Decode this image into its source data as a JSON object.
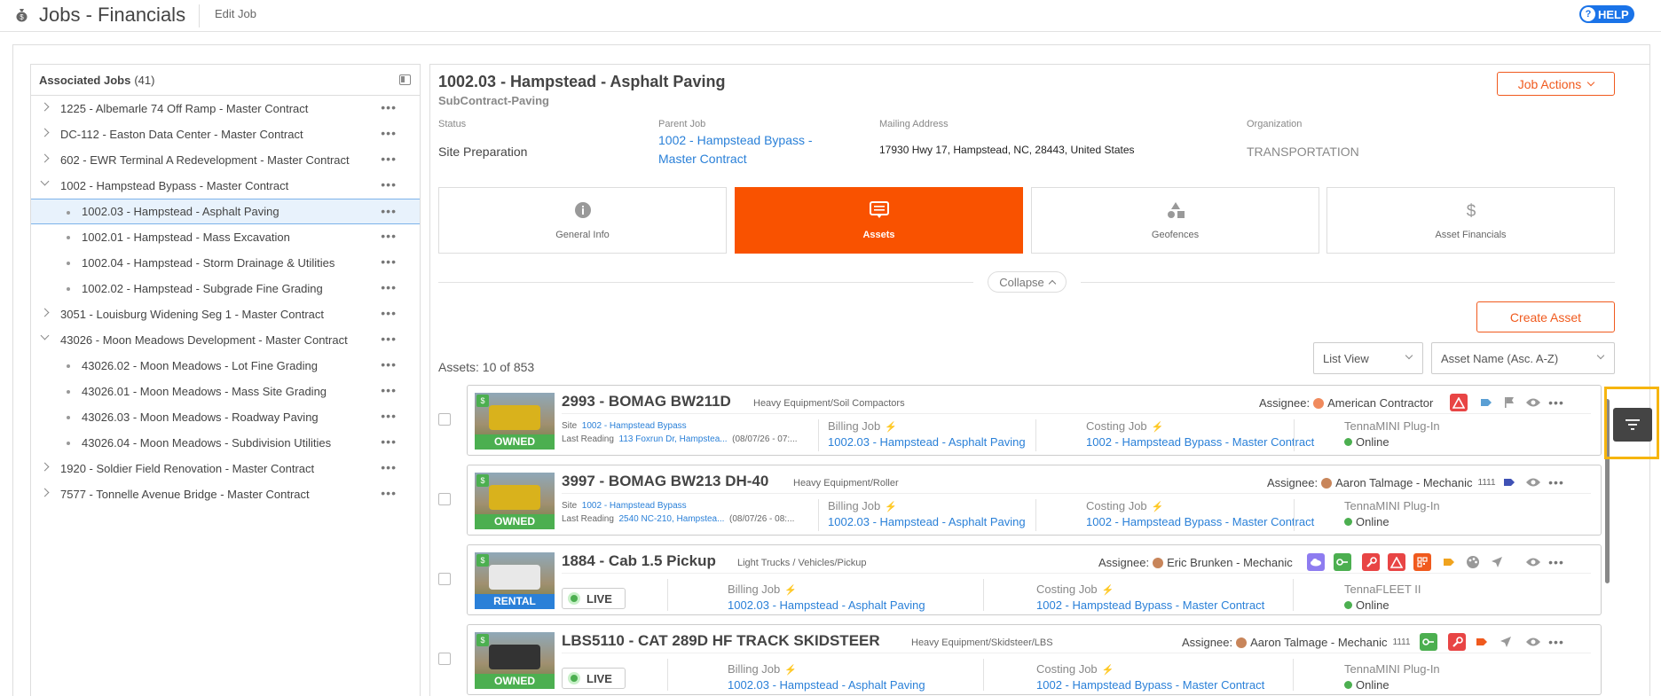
{
  "header": {
    "title": "Jobs - Financials",
    "edit_label": "Edit Job",
    "help_label": "HELP"
  },
  "left_panel": {
    "title": "Associated Jobs",
    "count": "(41)",
    "items": [
      {
        "label": "1225 - Albemarle 74 Off Ramp - Master Contract",
        "level": 0,
        "expanded": false
      },
      {
        "label": "DC-112 - Easton Data Center - Master Contract",
        "level": 0,
        "expanded": false
      },
      {
        "label": "602 - EWR Terminal A Redevelopment - Master Contract",
        "level": 0,
        "expanded": false
      },
      {
        "label": "1002 - Hampstead Bypass - Master Contract",
        "level": 0,
        "expanded": true
      },
      {
        "label": "1002.03 - Hampstead - Asphalt Paving",
        "level": 1,
        "selected": true
      },
      {
        "label": "1002.01 - Hampstead - Mass Excavation",
        "level": 1
      },
      {
        "label": "1002.04 - Hampstead - Storm Drainage & Utilities",
        "level": 1
      },
      {
        "label": "1002.02 - Hampstead - Subgrade Fine Grading",
        "level": 1
      },
      {
        "label": "3051 - Louisburg Widening Seg 1 - Master Contract",
        "level": 0,
        "expanded": false
      },
      {
        "label": "43026 - Moon Meadows Development - Master Contract",
        "level": 0,
        "expanded": true
      },
      {
        "label": "43026.02 - Moon Meadows - Lot Fine Grading",
        "level": 1
      },
      {
        "label": "43026.01 - Moon Meadows - Mass Site Grading",
        "level": 1
      },
      {
        "label": "43026.03 - Moon Meadows - Roadway Paving",
        "level": 1
      },
      {
        "label": "43026.04 - Moon Meadows - Subdivision Utilities",
        "level": 1
      },
      {
        "label": "1920 - Soldier Field Renovation - Master Contract",
        "level": 0,
        "expanded": false
      },
      {
        "label": "7577 - Tonnelle Avenue Bridge - Master Contract",
        "level": 0,
        "expanded": false
      }
    ]
  },
  "job": {
    "title": "1002.03 - Hampstead - Asphalt Paving",
    "subtitle": "SubContract-Paving",
    "actions_label": "Job Actions",
    "status_label": "Status",
    "status_value": "Site Preparation",
    "parent_label": "Parent Job",
    "parent_value": "1002 - Hampstead Bypass - Master Contract",
    "mailing_label": "Mailing Address",
    "mailing_value": "17930 Hwy 17, Hampstead, NC, 28443, United States",
    "org_label": "Organization",
    "org_value": "TRANSPORTATION"
  },
  "tabs": [
    {
      "label": "General Info",
      "icon": "info-icon",
      "active": false
    },
    {
      "label": "Assets",
      "icon": "list-icon",
      "active": true
    },
    {
      "label": "Geofences",
      "icon": "shapes-icon",
      "active": false
    },
    {
      "label": "Asset Financials",
      "icon": "dollar-icon",
      "active": false
    }
  ],
  "collapse_label": "Collapse",
  "create_asset_label": "Create Asset",
  "view_select": "List View",
  "sort_select": "Asset Name (Asc. A-Z)",
  "assets_count": "Assets: 10 of 853",
  "assets": [
    {
      "title": "2993 - BOMAG BW211D",
      "category": "Heavy Equipment/Soil Compactors",
      "ownership": "OWNED",
      "site_label": "Site",
      "site_value": "1002 - Hampstead Bypass",
      "reading_label": "Last Reading",
      "reading_value": "113 Foxrun Dr, Hampstea...",
      "reading_time": "(08/07/26 - 07:...",
      "assignee_label": "Assignee:",
      "assignee_name": "American Contractor",
      "assignee_num": "",
      "billing_label": "Billing Job",
      "billing_value": "1002.03 - Hampstead - Asphalt Paving",
      "costing_label": "Costing Job",
      "costing_value": "1002 - Hampstead Bypass - Master Contract",
      "device_label": "TennaMINI Plug-In",
      "device_status": "Online"
    },
    {
      "title": "3997 - BOMAG BW213 DH-40",
      "category": "Heavy Equipment/Roller",
      "ownership": "OWNED",
      "site_label": "Site",
      "site_value": "1002 - Hampstead Bypass",
      "reading_label": "Last Reading",
      "reading_value": "2540 NC-210, Hampstea...",
      "reading_time": "(08/07/26 - 08:...",
      "assignee_label": "Assignee:",
      "assignee_name": "Aaron Talmage - Mechanic",
      "assignee_num": "1111",
      "billing_label": "Billing Job",
      "billing_value": "1002.03 - Hampstead - Asphalt Paving",
      "costing_label": "Costing Job",
      "costing_value": "1002 - Hampstead Bypass - Master Contract",
      "device_label": "TennaMINI Plug-In",
      "device_status": "Online"
    },
    {
      "title": "1884 - Cab 1.5 Pickup",
      "category": "Light Trucks / Vehicles/Pickup",
      "ownership": "RENTAL",
      "live_label": "LIVE",
      "assignee_label": "Assignee:",
      "assignee_name": "Eric Brunken - Mechanic",
      "assignee_num": "",
      "billing_label": "Billing Job",
      "billing_value": "1002.03 - Hampstead - Asphalt Paving",
      "costing_label": "Costing Job",
      "costing_value": "1002 - Hampstead Bypass - Master Contract",
      "device_label": "TennaFLEET II",
      "device_status": "Online"
    },
    {
      "title": "LBS5110 - CAT 289D HF TRACK SKIDSTEER",
      "category": "Heavy Equipment/Skidsteer/LBS",
      "ownership": "OWNED",
      "live_label": "LIVE",
      "assignee_label": "Assignee:",
      "assignee_name": "Aaron Talmage - Mechanic",
      "assignee_num": "1111",
      "billing_label": "Billing Job",
      "billing_value": "1002.03 - Hampstead - Asphalt Paving",
      "costing_label": "Costing Job",
      "costing_value": "1002 - Hampstead Bypass - Master Contract",
      "device_label": "TennaMINI Plug-In",
      "device_status": "Online"
    }
  ],
  "colors": {
    "accent": "#f95200",
    "link": "#2a80d8",
    "online": "#4caf50",
    "highlight": "#f6b50e"
  }
}
